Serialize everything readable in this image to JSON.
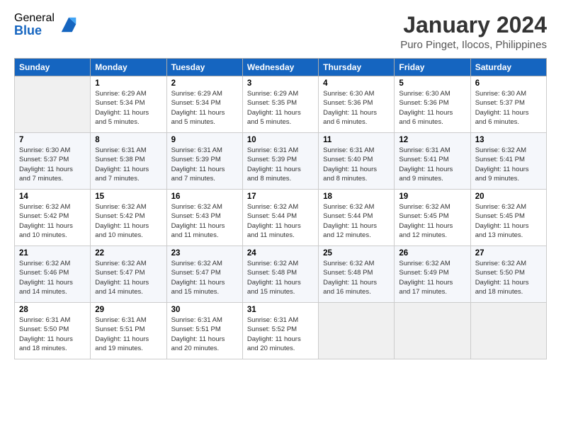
{
  "header": {
    "logo_general": "General",
    "logo_blue": "Blue",
    "month_title": "January 2024",
    "location": "Puro Pinget, Ilocos, Philippines"
  },
  "days_of_week": [
    "Sunday",
    "Monday",
    "Tuesday",
    "Wednesday",
    "Thursday",
    "Friday",
    "Saturday"
  ],
  "weeks": [
    [
      {
        "num": "",
        "empty": true
      },
      {
        "num": "1",
        "sunrise": "Sunrise: 6:29 AM",
        "sunset": "Sunset: 5:34 PM",
        "daylight": "Daylight: 11 hours and 5 minutes."
      },
      {
        "num": "2",
        "sunrise": "Sunrise: 6:29 AM",
        "sunset": "Sunset: 5:34 PM",
        "daylight": "Daylight: 11 hours and 5 minutes."
      },
      {
        "num": "3",
        "sunrise": "Sunrise: 6:29 AM",
        "sunset": "Sunset: 5:35 PM",
        "daylight": "Daylight: 11 hours and 5 minutes."
      },
      {
        "num": "4",
        "sunrise": "Sunrise: 6:30 AM",
        "sunset": "Sunset: 5:36 PM",
        "daylight": "Daylight: 11 hours and 6 minutes."
      },
      {
        "num": "5",
        "sunrise": "Sunrise: 6:30 AM",
        "sunset": "Sunset: 5:36 PM",
        "daylight": "Daylight: 11 hours and 6 minutes."
      },
      {
        "num": "6",
        "sunrise": "Sunrise: 6:30 AM",
        "sunset": "Sunset: 5:37 PM",
        "daylight": "Daylight: 11 hours and 6 minutes."
      }
    ],
    [
      {
        "num": "7",
        "sunrise": "Sunrise: 6:30 AM",
        "sunset": "Sunset: 5:37 PM",
        "daylight": "Daylight: 11 hours and 7 minutes."
      },
      {
        "num": "8",
        "sunrise": "Sunrise: 6:31 AM",
        "sunset": "Sunset: 5:38 PM",
        "daylight": "Daylight: 11 hours and 7 minutes."
      },
      {
        "num": "9",
        "sunrise": "Sunrise: 6:31 AM",
        "sunset": "Sunset: 5:39 PM",
        "daylight": "Daylight: 11 hours and 7 minutes."
      },
      {
        "num": "10",
        "sunrise": "Sunrise: 6:31 AM",
        "sunset": "Sunset: 5:39 PM",
        "daylight": "Daylight: 11 hours and 8 minutes."
      },
      {
        "num": "11",
        "sunrise": "Sunrise: 6:31 AM",
        "sunset": "Sunset: 5:40 PM",
        "daylight": "Daylight: 11 hours and 8 minutes."
      },
      {
        "num": "12",
        "sunrise": "Sunrise: 6:31 AM",
        "sunset": "Sunset: 5:41 PM",
        "daylight": "Daylight: 11 hours and 9 minutes."
      },
      {
        "num": "13",
        "sunrise": "Sunrise: 6:32 AM",
        "sunset": "Sunset: 5:41 PM",
        "daylight": "Daylight: 11 hours and 9 minutes."
      }
    ],
    [
      {
        "num": "14",
        "sunrise": "Sunrise: 6:32 AM",
        "sunset": "Sunset: 5:42 PM",
        "daylight": "Daylight: 11 hours and 10 minutes."
      },
      {
        "num": "15",
        "sunrise": "Sunrise: 6:32 AM",
        "sunset": "Sunset: 5:42 PM",
        "daylight": "Daylight: 11 hours and 10 minutes."
      },
      {
        "num": "16",
        "sunrise": "Sunrise: 6:32 AM",
        "sunset": "Sunset: 5:43 PM",
        "daylight": "Daylight: 11 hours and 11 minutes."
      },
      {
        "num": "17",
        "sunrise": "Sunrise: 6:32 AM",
        "sunset": "Sunset: 5:44 PM",
        "daylight": "Daylight: 11 hours and 11 minutes."
      },
      {
        "num": "18",
        "sunrise": "Sunrise: 6:32 AM",
        "sunset": "Sunset: 5:44 PM",
        "daylight": "Daylight: 11 hours and 12 minutes."
      },
      {
        "num": "19",
        "sunrise": "Sunrise: 6:32 AM",
        "sunset": "Sunset: 5:45 PM",
        "daylight": "Daylight: 11 hours and 12 minutes."
      },
      {
        "num": "20",
        "sunrise": "Sunrise: 6:32 AM",
        "sunset": "Sunset: 5:45 PM",
        "daylight": "Daylight: 11 hours and 13 minutes."
      }
    ],
    [
      {
        "num": "21",
        "sunrise": "Sunrise: 6:32 AM",
        "sunset": "Sunset: 5:46 PM",
        "daylight": "Daylight: 11 hours and 14 minutes."
      },
      {
        "num": "22",
        "sunrise": "Sunrise: 6:32 AM",
        "sunset": "Sunset: 5:47 PM",
        "daylight": "Daylight: 11 hours and 14 minutes."
      },
      {
        "num": "23",
        "sunrise": "Sunrise: 6:32 AM",
        "sunset": "Sunset: 5:47 PM",
        "daylight": "Daylight: 11 hours and 15 minutes."
      },
      {
        "num": "24",
        "sunrise": "Sunrise: 6:32 AM",
        "sunset": "Sunset: 5:48 PM",
        "daylight": "Daylight: 11 hours and 15 minutes."
      },
      {
        "num": "25",
        "sunrise": "Sunrise: 6:32 AM",
        "sunset": "Sunset: 5:48 PM",
        "daylight": "Daylight: 11 hours and 16 minutes."
      },
      {
        "num": "26",
        "sunrise": "Sunrise: 6:32 AM",
        "sunset": "Sunset: 5:49 PM",
        "daylight": "Daylight: 11 hours and 17 minutes."
      },
      {
        "num": "27",
        "sunrise": "Sunrise: 6:32 AM",
        "sunset": "Sunset: 5:50 PM",
        "daylight": "Daylight: 11 hours and 18 minutes."
      }
    ],
    [
      {
        "num": "28",
        "sunrise": "Sunrise: 6:31 AM",
        "sunset": "Sunset: 5:50 PM",
        "daylight": "Daylight: 11 hours and 18 minutes."
      },
      {
        "num": "29",
        "sunrise": "Sunrise: 6:31 AM",
        "sunset": "Sunset: 5:51 PM",
        "daylight": "Daylight: 11 hours and 19 minutes."
      },
      {
        "num": "30",
        "sunrise": "Sunrise: 6:31 AM",
        "sunset": "Sunset: 5:51 PM",
        "daylight": "Daylight: 11 hours and 20 minutes."
      },
      {
        "num": "31",
        "sunrise": "Sunrise: 6:31 AM",
        "sunset": "Sunset: 5:52 PM",
        "daylight": "Daylight: 11 hours and 20 minutes."
      },
      {
        "num": "",
        "empty": true
      },
      {
        "num": "",
        "empty": true
      },
      {
        "num": "",
        "empty": true
      }
    ]
  ]
}
